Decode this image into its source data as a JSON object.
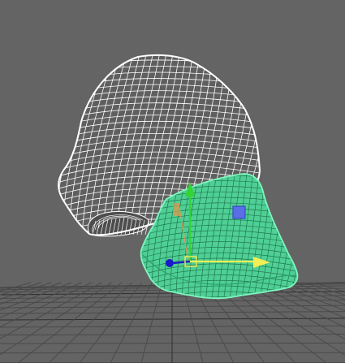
{
  "viewport": {
    "background": "#646464",
    "grid_color": "#4a4a4a",
    "grid_major_color": "#2e2e2e"
  },
  "objects": [
    {
      "name": "upper-mesh",
      "state": "unselected",
      "wire_color": "#ffffff"
    },
    {
      "name": "lower-mesh",
      "state": "selected",
      "wire_color": "#3ce89a",
      "fill_color": "#4dcf96"
    }
  ],
  "gizmo": {
    "type": "move-manipulator",
    "x_axis_color": "#f2ee55",
    "y_axis_color": "#32d532",
    "z_axis_color": "#1a1ac8",
    "center_plane_color": "#5a6ee6"
  }
}
